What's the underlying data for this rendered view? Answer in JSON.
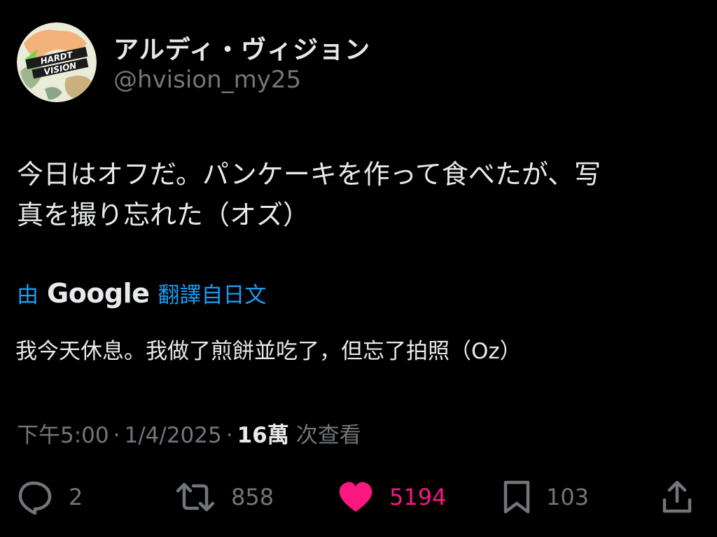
{
  "user": {
    "display_name": "アルディ・ヴィジョン",
    "handle": "@hvision_my25",
    "avatar_logo_text": "HARDT VISION"
  },
  "tweet": {
    "text_line1": "今日はオフだ。パンケーキを作って食べたが、写",
    "text_line2": "真を撮り忘れた（オズ）"
  },
  "translation": {
    "prefix": "由",
    "provider": "Google",
    "suffix": "翻譯自日文",
    "text": "我今天休息。我做了煎餅並吃了，但忘了拍照（Oz）"
  },
  "meta": {
    "time": "下午5:00",
    "separator": "·",
    "date": "1/4/2025",
    "views_count": "16萬",
    "views_label": "次查看"
  },
  "actions": {
    "replies": "2",
    "reposts": "858",
    "likes": "5194",
    "bookmarks": "103"
  },
  "colors": {
    "background": "#000000",
    "text_primary": "#e7e9ea",
    "text_secondary": "#71767b",
    "link_blue": "#1d9bf0",
    "like_pink": "#f91880"
  }
}
